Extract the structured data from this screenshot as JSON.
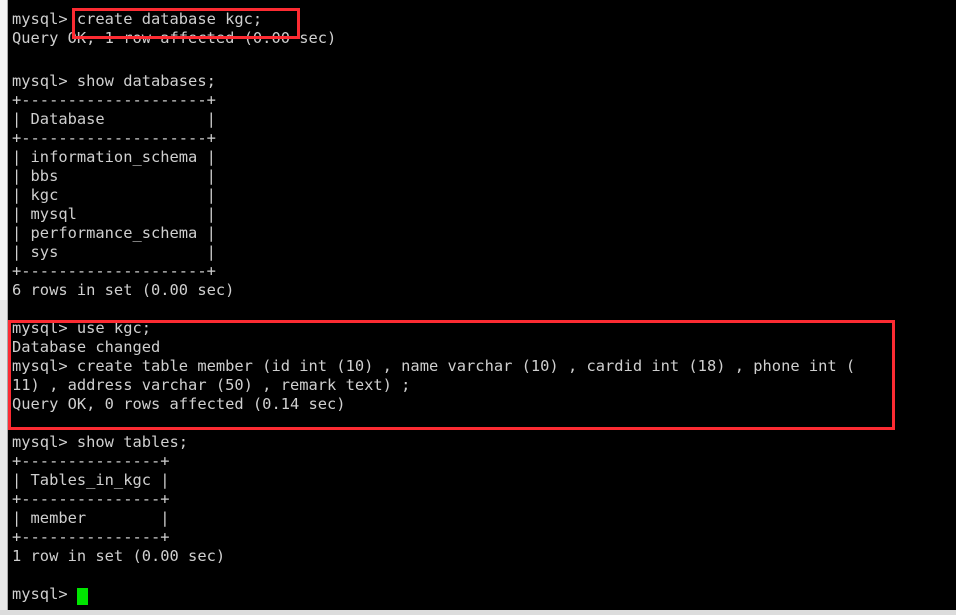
{
  "terminal": {
    "prompt": "mysql>",
    "colors": {
      "background": "#000000",
      "foreground": "#cfcfcf",
      "cursor": "#00e500",
      "highlight": "#fc2b32",
      "scrollbar": "#e8e8e8"
    },
    "lines": [
      "mysql> create database kgc;",
      "Query OK, 1 row affected (0.00 sec)",
      "",
      "mysql> show databases;",
      "+--------------------+",
      "| Database           |",
      "+--------------------+",
      "| information_schema |",
      "| bbs                |",
      "| kgc                |",
      "| mysql              |",
      "| performance_schema |",
      "| sys                |",
      "+--------------------+",
      "6 rows in set (0.00 sec)",
      "",
      "mysql> use kgc;",
      "Database changed",
      "mysql> create table member (id int (10) , name varchar (10) , cardid int (18) , phone int (",
      "11) , address varchar (50) , remark text) ;",
      "Query OK, 0 rows affected (0.14 sec)",
      "mysql> show tables;",
      "+---------------+",
      "| Tables_in_kgc |",
      "+---------------+",
      "| member        |",
      "+---------------+",
      "1 row in set (0.00 sec)",
      "",
      "mysql> "
    ],
    "highlights": [
      {
        "name": "create-database-statement",
        "text": "create database kgc;"
      },
      {
        "name": "create-table-block",
        "text": "mysql> use kgc; / Database changed / mysql> create table member (id int (10) , name varchar (10) , cardid int (18) , phone int (11) , address varchar (50) , remark text) ; / Query OK, 0 rows affected (0.14 sec)"
      }
    ],
    "results": {
      "databases_header": "Database",
      "databases": [
        "information_schema",
        "bbs",
        "kgc",
        "mysql",
        "performance_schema",
        "sys"
      ],
      "databases_count_text": "6 rows in set (0.00 sec)",
      "tables_header": "Tables_in_kgc",
      "tables": [
        "member"
      ],
      "tables_count_text": "1 row in set (0.00 sec)",
      "create_database_status": "Query OK, 1 row affected (0.00 sec)",
      "use_database_status": "Database changed",
      "create_table_status": "Query OK, 0 rows affected (0.14 sec)"
    }
  }
}
